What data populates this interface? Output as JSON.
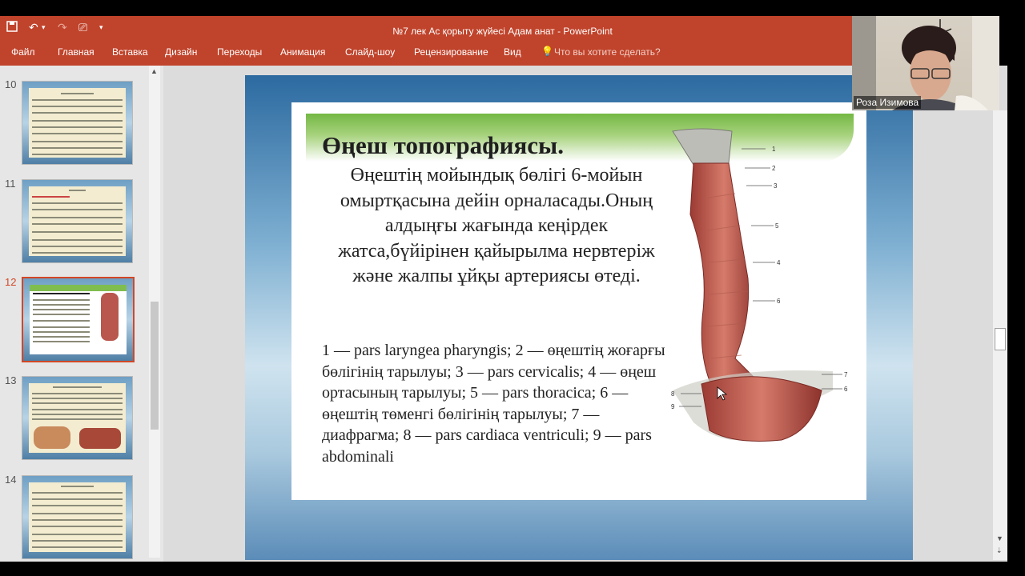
{
  "window": {
    "title": "№7 лек Ас қорыту жүйесі Адам анат - PowerPoint"
  },
  "quick_access": {
    "icons": [
      "save-icon",
      "undo-icon",
      "redo-icon",
      "start-from-beginning-icon",
      "customize-icon"
    ]
  },
  "ribbon_tabs": [
    {
      "label": "Файл"
    },
    {
      "label": "Главная"
    },
    {
      "label": "Вставка"
    },
    {
      "label": "Дизайн"
    },
    {
      "label": "Переходы"
    },
    {
      "label": "Анимация"
    },
    {
      "label": "Слайд-шоу"
    },
    {
      "label": "Рецензирование"
    },
    {
      "label": "Вид"
    }
  ],
  "tell_me": {
    "placeholder": "Что вы хотите сделать?",
    "icon": "lightbulb-icon"
  },
  "thumbnails": [
    {
      "number": "10",
      "selected": false
    },
    {
      "number": "11",
      "selected": false
    },
    {
      "number": "12",
      "selected": true
    },
    {
      "number": "13",
      "selected": false
    },
    {
      "number": "14",
      "selected": false
    }
  ],
  "slide": {
    "heading": "Өңеш топографиясы.",
    "body": "Өңештің мойындық бөлігі 6-мойын омыртқасына дейін орналасады.Оның алдыңғы жағында кеңірдек жатса,бүйірінен қайырылма нервтеріж және жалпы ұйқы артериясы өтеді.",
    "legend": "1 — pars laryngea pharyngis; 2 — өңештің жоғарғы бөлігінің тарылуы; 3 — pars cervicalis; 4 — өңеш ортасының тарылуы; 5 — pars thoracica; 6 — өңештің төменгі бөлігінің тарылуы; 7 — диафрагма; 8 — pars cardiaca ventriculi; 9 — pars abdominali",
    "figure_labels": [
      "1",
      "2",
      "3",
      "5",
      "4",
      "6",
      "7",
      "6",
      "8",
      "9"
    ]
  },
  "webcam": {
    "participant_name": "Роза Изимова"
  },
  "colors": {
    "ribbon": "#c0432b",
    "accent_selected": "#d24726",
    "slide_green": "#74b844"
  }
}
